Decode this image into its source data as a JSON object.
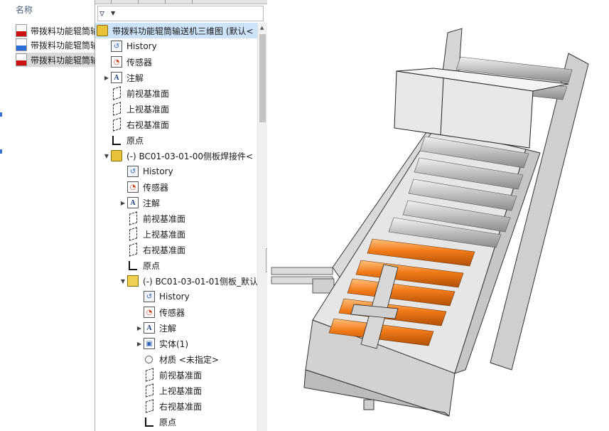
{
  "explorer": {
    "column_header": "名称",
    "files": [
      {
        "name": "带拨料功能辊筒输",
        "type": "pdf",
        "selected": false
      },
      {
        "name": "带拨料功能辊筒输",
        "type": "rar",
        "selected": false
      },
      {
        "name": "带拨料功能辊筒输",
        "type": "sldasm",
        "selected": true
      }
    ]
  },
  "tree": {
    "filter_icon": "funnel-icon",
    "root": {
      "label": "带拨料功能辊筒输送机三维图 (默认<",
      "icon": "assembly-icon"
    },
    "items": [
      {
        "label": "History",
        "icon": "history-icon",
        "level": 1
      },
      {
        "label": "传感器",
        "icon": "sensor-icon",
        "level": 1
      },
      {
        "label": "注解",
        "icon": "annotation-icon",
        "level": 1,
        "expandable": true
      },
      {
        "label": "前视基准面",
        "icon": "plane-icon",
        "level": 1
      },
      {
        "label": "上视基准面",
        "icon": "plane-icon",
        "level": 1
      },
      {
        "label": "右视基准面",
        "icon": "plane-icon",
        "level": 1
      },
      {
        "label": "原点",
        "icon": "origin-icon",
        "level": 1
      },
      {
        "label": "(-) BC01-03-01-00侧板焊接件<",
        "icon": "assembly-icon",
        "level": 1,
        "expanded": true
      },
      {
        "label": "History",
        "icon": "history-icon",
        "level": 2
      },
      {
        "label": "传感器",
        "icon": "sensor-icon",
        "level": 2
      },
      {
        "label": "注解",
        "icon": "annotation-icon",
        "level": 2,
        "expandable": true
      },
      {
        "label": "前视基准面",
        "icon": "plane-icon",
        "level": 2
      },
      {
        "label": "上视基准面",
        "icon": "plane-icon",
        "level": 2
      },
      {
        "label": "右视基准面",
        "icon": "plane-icon",
        "level": 2
      },
      {
        "label": "原点",
        "icon": "origin-icon",
        "level": 2
      },
      {
        "label": "(-) BC01-03-01-01侧板_默认",
        "icon": "part-icon",
        "level": 2,
        "expanded": true
      },
      {
        "label": "History",
        "icon": "history-icon",
        "level": 3
      },
      {
        "label": "传感器",
        "icon": "sensor-icon",
        "level": 3
      },
      {
        "label": "注解",
        "icon": "annotation-icon",
        "level": 3,
        "expandable": true
      },
      {
        "label": "实体(1)",
        "icon": "solid-body-icon",
        "level": 3,
        "expandable": true
      },
      {
        "label": "材质 <未指定>",
        "icon": "material-icon",
        "level": 3
      },
      {
        "label": "前视基准面",
        "icon": "plane-icon",
        "level": 3
      },
      {
        "label": "上视基准面",
        "icon": "plane-icon",
        "level": 3
      },
      {
        "label": "右视基准面",
        "icon": "plane-icon",
        "level": 3
      },
      {
        "label": "原点",
        "icon": "origin-icon",
        "level": 3
      }
    ]
  },
  "viewport": {
    "model": "roller-conveyor-3d",
    "colors": {
      "frame": "#d4d4d4",
      "frame_edge": "#3a3a3a",
      "roller_gray": "#c8c8c8",
      "roller_orange": "#f07a18",
      "motor_red": "#d8242c"
    }
  }
}
